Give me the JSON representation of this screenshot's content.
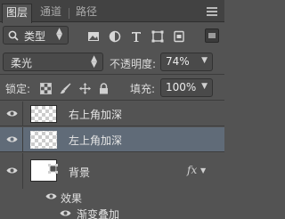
{
  "tabs": [
    {
      "label": "图层",
      "active": true
    },
    {
      "label": "通道",
      "active": false
    },
    {
      "label": "路径",
      "active": false
    }
  ],
  "filter": {
    "kind_label": "类型",
    "icons": [
      "image-filter-icon",
      "adjustment-filter-icon",
      "type-filter-icon",
      "shape-filter-icon",
      "smart-object-filter-icon"
    ]
  },
  "blend": {
    "mode": "柔光",
    "opacity_label": "不透明度:",
    "opacity_value": "74%"
  },
  "lock": {
    "label": "锁定:",
    "icons": [
      "lock-transparent-icon",
      "lock-paint-icon",
      "lock-position-icon",
      "lock-all-icon"
    ],
    "fill_label": "填充:",
    "fill_value": "100%"
  },
  "layers": [
    {
      "name": "右上角加深",
      "selected": false,
      "visible": true
    },
    {
      "name": "左上角加深",
      "selected": true,
      "visible": true
    },
    {
      "name": "背景",
      "selected": false,
      "visible": true,
      "fx": "fx"
    }
  ],
  "effects": {
    "label": "效果",
    "items": [
      "渐变叠加"
    ]
  },
  "colors": {
    "panel_bg": "#535353",
    "selected_row": "#606b78",
    "tabbar_bg": "#424242"
  }
}
